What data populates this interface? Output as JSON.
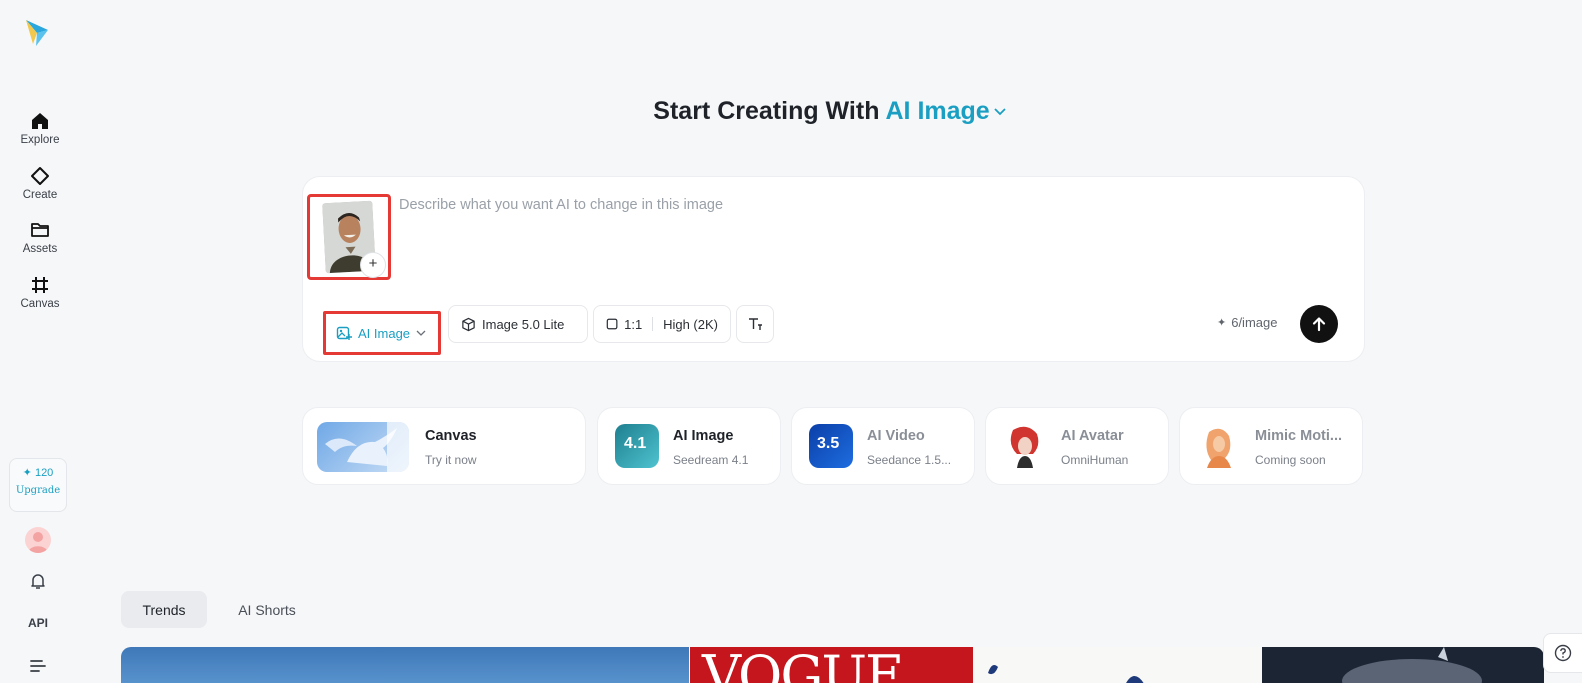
{
  "sidebar": {
    "items": [
      {
        "label": "Explore",
        "icon": "home-icon"
      },
      {
        "label": "Create",
        "icon": "sparkle-diamond-icon"
      },
      {
        "label": "Assets",
        "icon": "folder-icon"
      },
      {
        "label": "Canvas",
        "icon": "canvas-grid-icon"
      }
    ],
    "credits": "✦ 120",
    "upgrade_label": "Upgrade",
    "api_label": "API"
  },
  "heading": {
    "prefix": "Start Creating With ",
    "accent": "AI Image"
  },
  "prompt": {
    "placeholder": "Describe what you want AI to change in this image",
    "value": ""
  },
  "toolbar": {
    "mode_label": "AI Image",
    "model_label": "Image 5.0 Lite",
    "ratio_label": "1:1",
    "quality_label": "High (2K)",
    "cost_label": "6/image"
  },
  "cards": [
    {
      "title": "Canvas",
      "subtitle": "Try it now"
    },
    {
      "title": "AI Image",
      "subtitle": "Seedream 4.1",
      "badge": "4.1"
    },
    {
      "title": "AI Video",
      "subtitle": "Seedance 1.5...",
      "badge": "3.5"
    },
    {
      "title": "AI Avatar",
      "subtitle": "OmniHuman"
    },
    {
      "title": "Mimic Moti...",
      "subtitle": "Coming soon"
    }
  ],
  "tabs": [
    {
      "label": "Trends",
      "active": true
    },
    {
      "label": "AI Shorts",
      "active": false
    }
  ],
  "gallery": {
    "vogue_text": "VOGUE"
  },
  "colors": {
    "accent": "#1a9fc2",
    "highlight_box": "#e53935",
    "send_button": "#111111"
  }
}
